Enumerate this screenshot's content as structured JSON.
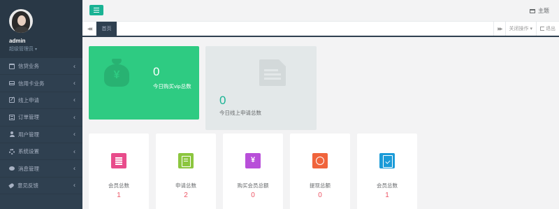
{
  "profile": {
    "name": "admin",
    "role": "超级管理员",
    "role_caret": "▾"
  },
  "sidebar": {
    "items": [
      {
        "label": "信贷业务",
        "icon": "calendar-icon"
      },
      {
        "label": "信用卡业务",
        "icon": "credit-card-icon"
      },
      {
        "label": "线上申请",
        "icon": "edit-icon"
      },
      {
        "label": "订单管理",
        "icon": "list-icon"
      },
      {
        "label": "用户管理",
        "icon": "user-icon"
      },
      {
        "label": "系统设置",
        "icon": "gears-icon"
      },
      {
        "label": "消息管理",
        "icon": "comment-icon"
      },
      {
        "label": "意见反馈",
        "icon": "tag-icon"
      }
    ],
    "arrow": "‹"
  },
  "topbar": {
    "theme_label": "主题"
  },
  "tabs": {
    "left_nav": "◀◀",
    "home": "首页",
    "right_nav": "▶▶",
    "close_ops": "关闭操作 ▾",
    "logout": "退出"
  },
  "stats": {
    "vip": {
      "value": "0",
      "label": "今日购买vip总数"
    },
    "online": {
      "value": "0",
      "label": "今日线上申请总数"
    }
  },
  "cards": [
    {
      "label": "会员总数",
      "value": "1",
      "color": "#e84c8b"
    },
    {
      "label": "申请总数",
      "value": "2",
      "color": "#8cc63f"
    },
    {
      "label": "购买会员总额",
      "value": "0",
      "color": "#b84fd9"
    },
    {
      "label": "提现总额",
      "value": "0",
      "color": "#f0643c"
    },
    {
      "label": "会员总数",
      "value": "1",
      "color": "#1b9bd8"
    }
  ],
  "colors": {
    "sidebar": "#2f4050",
    "accent": "#1ab394",
    "green_box": "#2ecb82",
    "gray_box": "#e3e8e9",
    "value_red": "#ed5565"
  }
}
